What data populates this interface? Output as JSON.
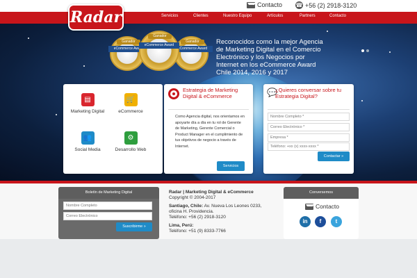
{
  "brand": {
    "logo": "Radar"
  },
  "topbar": {
    "contact": "Contacto",
    "phone": "+56 (2) 2918-3120"
  },
  "nav": {
    "items": [
      "Servicios",
      "Clientes",
      "Nuestro Equipo",
      "Artículos",
      "Partners",
      "Contacto"
    ]
  },
  "hero": {
    "text": "Reconocidos como la mejor Agencia de Marketing Digital en el Comercio Electrónico y los Negocios por Internet en los eCommerce Award Chile 2014, 2016 y 2017",
    "medal_top": "Ganador",
    "medal_ribbon": "eCommerce Award"
  },
  "services": {
    "items": [
      {
        "label": "Marketing Digital",
        "icon": "marketing-icon",
        "color": "#d9262e"
      },
      {
        "label": "eCommerce",
        "icon": "cart-icon",
        "color": "#f0b000"
      },
      {
        "label": "Social Media",
        "icon": "social-icon",
        "color": "#1f8bc7"
      },
      {
        "label": "Desarrollo Web",
        "icon": "web-dev-icon",
        "color": "#2e9e3e"
      }
    ]
  },
  "strategy": {
    "title": "Estrategia de Marketing Digital & eCommerce",
    "body": "Como Agencia digital, nos orientamos en apoyarte día a día en tu rol de Gerente de Marketing, Gerente Comercial o Product Manager en el cumplimiento de tus objetivos de negocio a través de Internet.",
    "button": "Servicios"
  },
  "contact_form": {
    "title": "¿Quieres conversar sobre tu Estrategia Digital?",
    "name_placeholder": "Nombre Completo *",
    "email_placeholder": "Correo Electrónico *",
    "company_placeholder": "Empresa *",
    "phone_placeholder": "Teléfono: +xx (x) xxxx-xxxx *",
    "button": "Contactar »"
  },
  "newsletter": {
    "title": "Boletín de Marketing Digital",
    "name_placeholder": "Nombre Completo",
    "email_placeholder": "Correo Electrónico",
    "button": "Suscribirme »"
  },
  "company": {
    "name": "Radar | Marketing Digital & eCommerce",
    "copyright": "Copyright © 2004-2017",
    "santiago_label": "Santiago, Chile:",
    "santiago_address": "Av. Nueva Los Leones 0233, oficina H. Providencia.",
    "santiago_phone": "Teléfono: +56 (2) 2918-3120",
    "lima_label": "Lima, Perú:",
    "lima_phone": "Teléfono: +51 (9) 8333-7766"
  },
  "talk": {
    "title": "Conversemos",
    "contact": "Contacto",
    "social": [
      {
        "label": "in",
        "icon": "linkedin-icon",
        "color": "#1f6fa8"
      },
      {
        "label": "f",
        "icon": "facebook-icon",
        "color": "#1d4e9a"
      },
      {
        "label": "t",
        "icon": "twitter-icon",
        "color": "#3aa4dd"
      }
    ]
  }
}
